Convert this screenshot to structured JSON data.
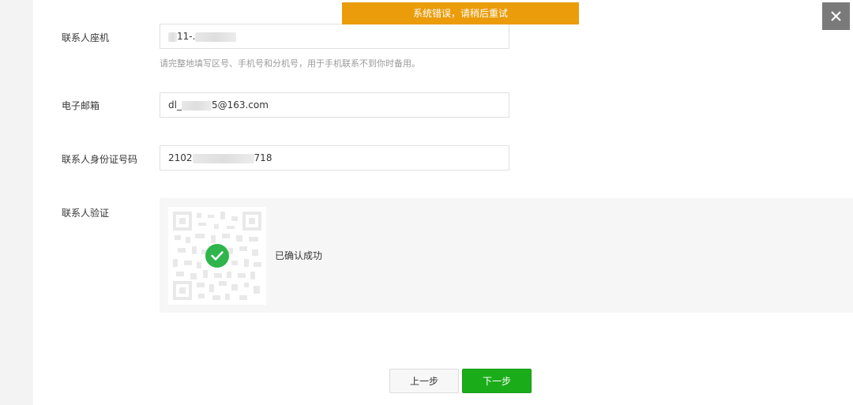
{
  "toast": {
    "text": "系统错误，请稍后重试"
  },
  "close_icon": "close-icon",
  "form": {
    "landline": {
      "label": "联系人座机",
      "value_visible": "11-.",
      "hint": "请完整地填写区号、手机号和分机号，用于手机联系不到你时备用。"
    },
    "email": {
      "label": "电子邮箱",
      "value_prefix": "dl_",
      "value_suffix": "5@163.com"
    },
    "id_number": {
      "label": "联系人身份证号码",
      "value_prefix": "2102",
      "value_suffix": "718"
    },
    "verification": {
      "label": "联系人验证",
      "status": "已确认成功",
      "status_icon": "check-circle-icon"
    }
  },
  "buttons": {
    "prev": "上一步",
    "next": "下一步"
  },
  "colors": {
    "toast_bg": "#ea9c0a",
    "primary": "#1aad19",
    "success": "#2fb54b",
    "close_bg": "#7a7a7a"
  }
}
